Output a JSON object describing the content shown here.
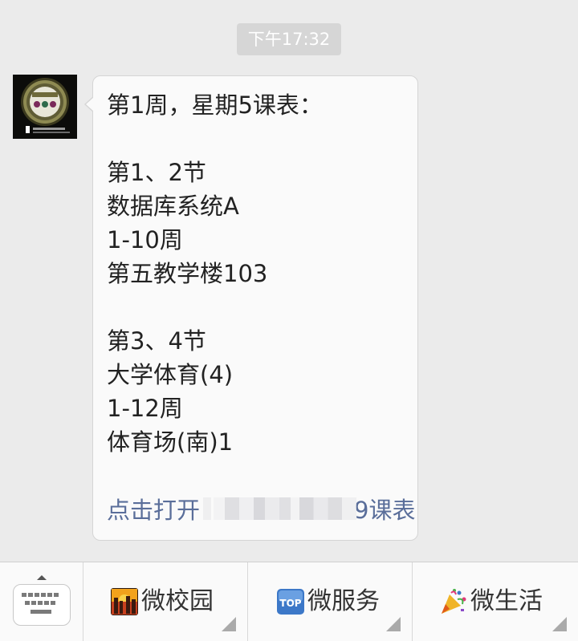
{
  "chat": {
    "timestamp": "下午17:32",
    "message": {
      "title": "第1周，星期5课表：",
      "lines": [
        "第1、2节",
        "数据库系统A",
        "1-10周",
        "第五教学楼103",
        "第3、4节",
        "大学体育(4)",
        "1-12周",
        "体育场(南)1"
      ],
      "link_prefix": "点击打开",
      "link_suffix": "9课表"
    }
  },
  "footer": {
    "menus": [
      {
        "label": "微校园",
        "icon": "campus-icon"
      },
      {
        "label": "微服务",
        "icon": "top-icon"
      },
      {
        "label": "微生活",
        "icon": "party-popper-icon"
      }
    ],
    "keyboard_icon": "keyboard-icon"
  }
}
